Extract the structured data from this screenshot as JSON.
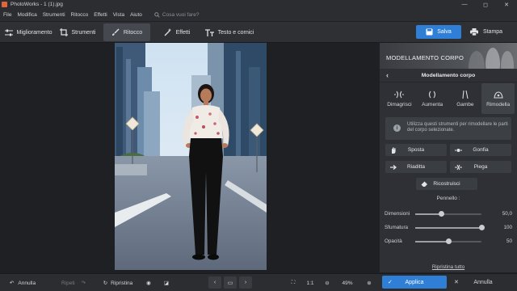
{
  "window": {
    "title": "PhotoWorks - 1 (1).jpg",
    "app_icon": "photoworks-logo-icon"
  },
  "menu": [
    "File",
    "Modifica",
    "Strumenti",
    "Ritocco",
    "Effetti",
    "Vista",
    "Aiuto"
  ],
  "search": {
    "placeholder": "Cosa vuoi fare?"
  },
  "toolbar": {
    "tabs": [
      {
        "label": "Miglioramento",
        "icon": "sliders-icon"
      },
      {
        "label": "Strumenti",
        "icon": "crop-icon"
      },
      {
        "label": "Ritocco",
        "icon": "brush-icon",
        "active": true
      },
      {
        "label": "Effetti",
        "icon": "magic-wand-icon"
      },
      {
        "label": "Testo e cornici",
        "icon": "text-icon"
      }
    ],
    "save_label": "Salva",
    "print_label": "Stampa"
  },
  "panel": {
    "banner_title": "MODELLAMENTO CORPO",
    "header_title": "Modellamento corpo",
    "tabs": [
      {
        "label": "Dimagrisci",
        "icon": "slim-icon"
      },
      {
        "label": "Aumenta",
        "icon": "enlarge-icon"
      },
      {
        "label": "Gambe",
        "icon": "legs-icon"
      },
      {
        "label": "Rimodella",
        "icon": "reshape-icon",
        "active": true
      }
    ],
    "info_text": "Utilizza questi strumenti per rimodellare le parti del corpo selezionate.",
    "tools": {
      "sposta": "Sposta",
      "gonfia": "Gonfia",
      "riaditta": "Riaditta",
      "piega": "Piega",
      "ricostruisci": "Ricostruisci"
    },
    "brush_title": "Pennello :",
    "sliders": [
      {
        "label": "Dimensioni",
        "value": "50,0",
        "level": 0.4
      },
      {
        "label": "Sfumatura",
        "value": "100",
        "level": 1.0
      },
      {
        "label": "Opacità",
        "value": "50",
        "level": 0.5
      }
    ],
    "reset_label": "Ripristina tutto"
  },
  "bottom": {
    "undo": "Annulla",
    "redo": "Ripeti",
    "restore": "Ripristina",
    "zoom_ratio": "1:1",
    "zoom_percent": "49%",
    "apply": "Applica",
    "cancel": "Annulla"
  },
  "colors": {
    "accent": "#2f7fd6",
    "panel": "#2e3035",
    "background": "#1f2023"
  }
}
